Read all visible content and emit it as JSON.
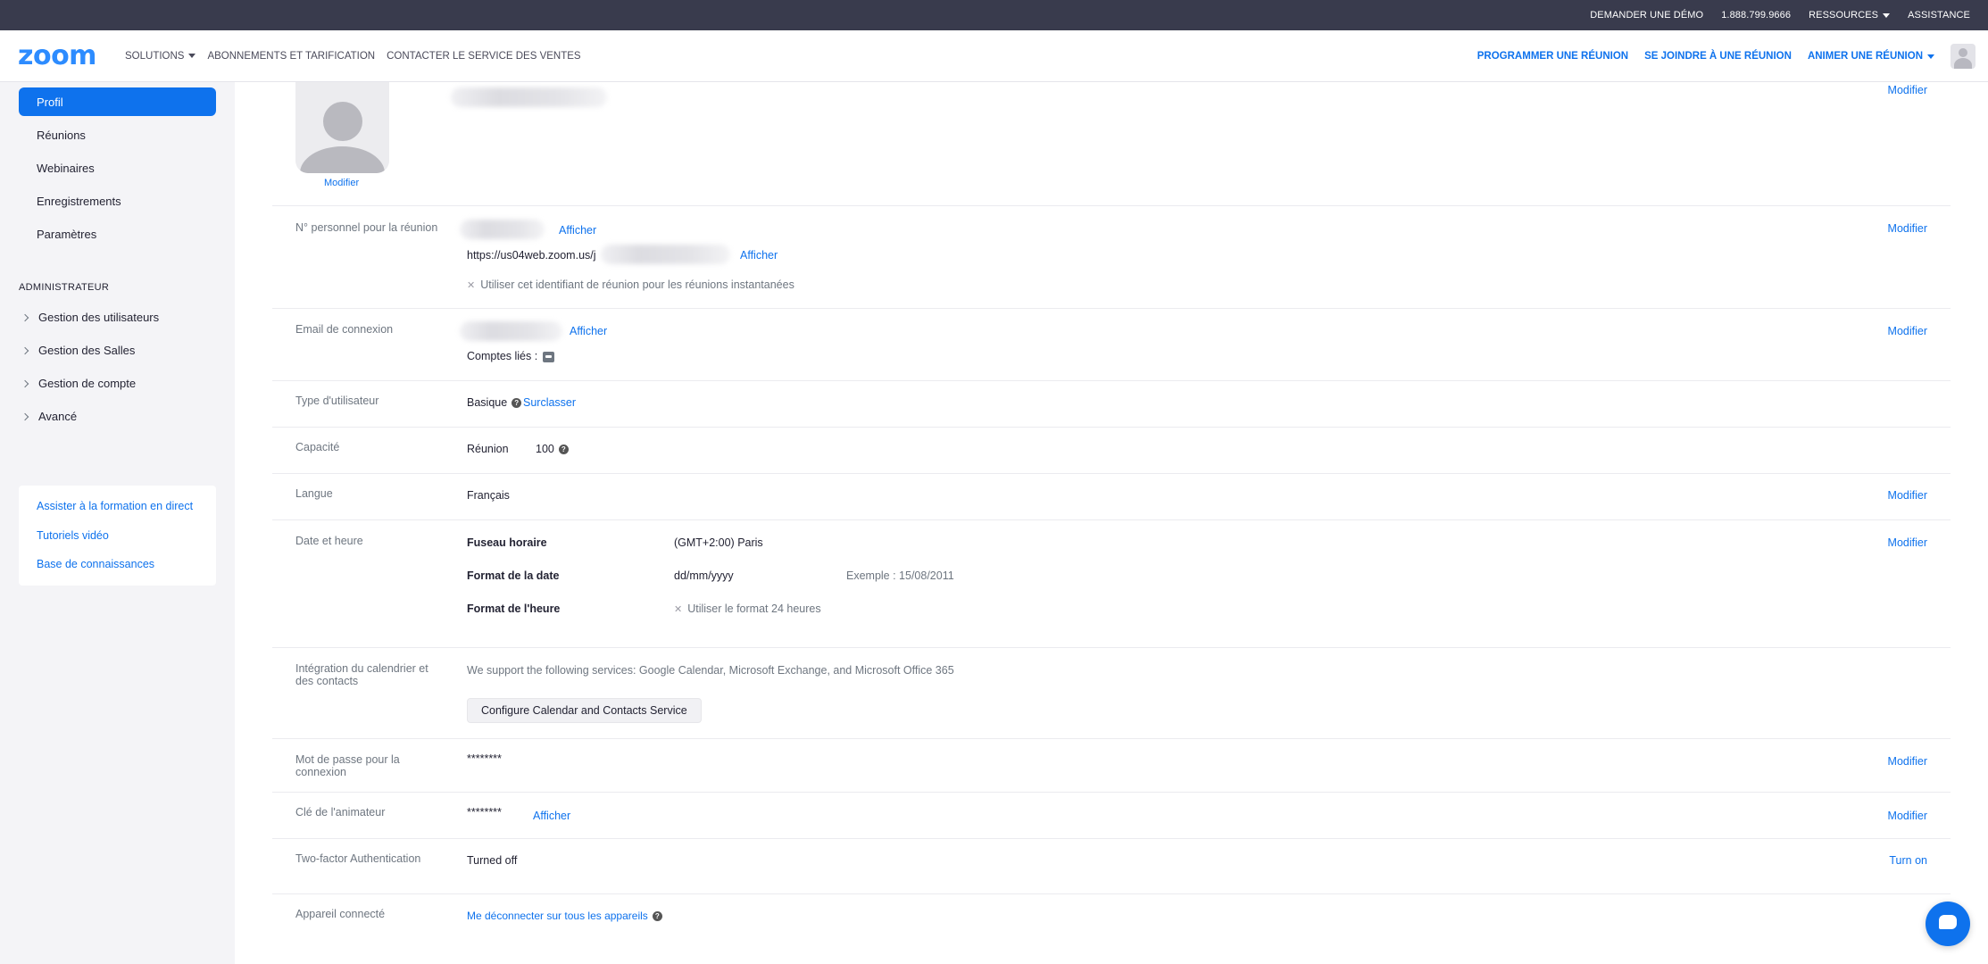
{
  "topbar": {
    "demo": "DEMANDER UNE DÉMO",
    "phone": "1.888.799.9666",
    "resources": "RESSOURCES",
    "support": "ASSISTANCE"
  },
  "nav": {
    "logo": "zoom",
    "solutions": "SOLUTIONS",
    "plans": "ABONNEMENTS ET TARIFICATION",
    "contact_sales": "CONTACTER LE SERVICE DES VENTES",
    "schedule": "PROGRAMMER UNE RÉUNION",
    "join": "SE JOINDRE À UNE RÉUNION",
    "host": "ANIMER UNE RÉUNION"
  },
  "sidebar": {
    "items": [
      "Profil",
      "Réunions",
      "Webinaires",
      "Enregistrements",
      "Paramètres"
    ],
    "admin_title": "ADMINISTRATEUR",
    "admin_items": [
      "Gestion des utilisateurs",
      "Gestion des Salles",
      "Gestion de compte",
      "Avancé"
    ],
    "help_links": [
      "Assister à la formation en direct",
      "Tutoriels vidéo",
      "Base de connaissances"
    ]
  },
  "profile": {
    "edit_photo": "Modifier",
    "edit": "Modifier",
    "pmi": {
      "label": "N° personnel pour la réunion",
      "show": "Afficher",
      "url_prefix": "https://us04web.zoom.us/j",
      "show_url": "Afficher",
      "instant": "Utiliser cet identifiant de réunion pour les réunions instantanées",
      "edit": "Modifier"
    },
    "email": {
      "label": "Email de connexion",
      "show": "Afficher",
      "linked": "Comptes liés :",
      "edit": "Modifier"
    },
    "user_type": {
      "label": "Type d'utilisateur",
      "value": "Basique",
      "upgrade": "Surclasser"
    },
    "capacity": {
      "label": "Capacité",
      "meeting": "Réunion",
      "value": "100"
    },
    "language": {
      "label": "Langue",
      "value": "Français",
      "edit": "Modifier"
    },
    "datetime": {
      "label": "Date et heure",
      "tz_label": "Fuseau horaire",
      "tz_value": "(GMT+2:00) Paris",
      "date_label": "Format de la date",
      "date_value": "dd/mm/yyyy",
      "date_example": "Exemple : 15/08/2011",
      "time_label": "Format de l'heure",
      "time_value": "Utiliser le format 24 heures",
      "edit": "Modifier"
    },
    "calendar": {
      "label_line1": "Intégration du calendrier et",
      "label_line2": "des contacts",
      "desc": "We support the following services: Google Calendar, Microsoft Exchange, and Microsoft Office 365",
      "button": "Configure Calendar and Contacts Service"
    },
    "password": {
      "label_line1": "Mot de passe pour la",
      "label_line2": "connexion",
      "value": "********",
      "edit": "Modifier"
    },
    "host_key": {
      "label": "Clé de l'animateur",
      "value": "********",
      "show": "Afficher",
      "edit": "Modifier"
    },
    "two_factor": {
      "label": "Two-factor Authentication",
      "value": "Turned off",
      "action": "Turn on"
    },
    "devices": {
      "label": "Appareil connecté",
      "action": "Me déconnecter sur tous les appareils"
    }
  }
}
